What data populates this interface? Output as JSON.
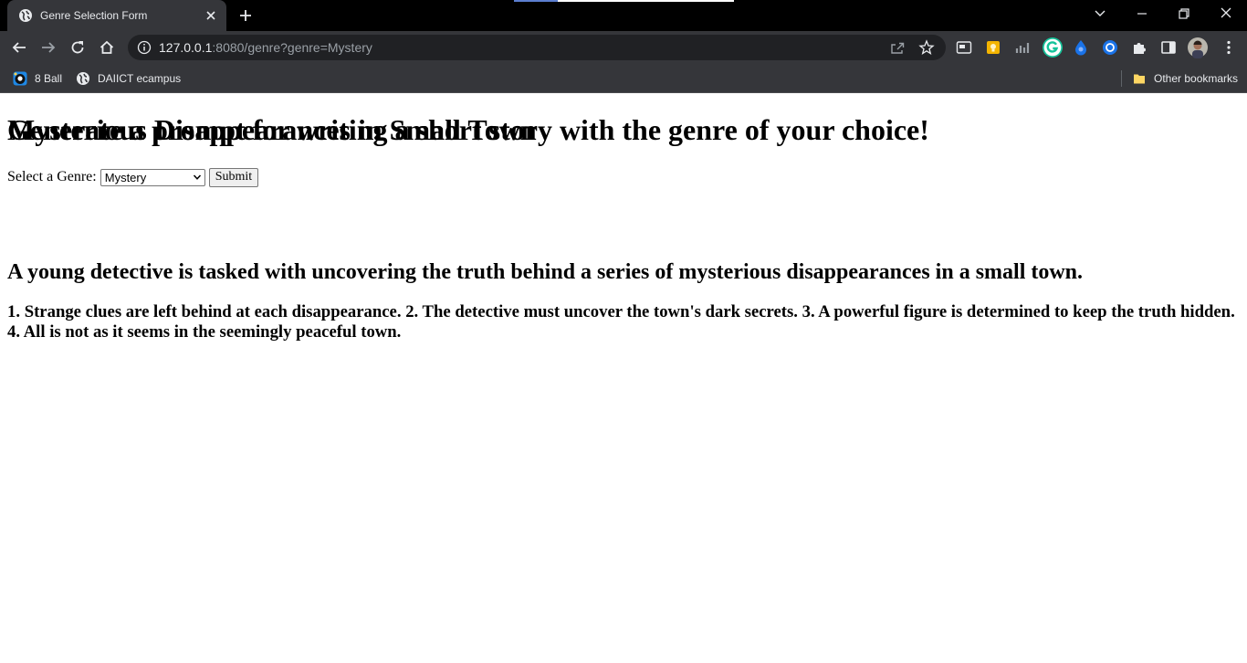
{
  "browser": {
    "tab_title": "Genre Selection Form",
    "url_host": "127.0.0.1",
    "url_rest": ":8080/genre?genre=Mystery",
    "bookmarks": [
      {
        "label": "8 Ball",
        "icon": "magic-8-ball-icon"
      },
      {
        "label": "DAIICT ecampus",
        "icon": "globe-icon"
      }
    ],
    "other_bookmarks": "Other bookmarks"
  },
  "page": {
    "heading": "Generate a prompt for writing a short story with the genre of your choice!",
    "form": {
      "label": "Select a Genre:",
      "selected_genre": "Mystery",
      "submit_label": "Submit"
    },
    "story": {
      "title": "Mysterious Disappearances in Small Town",
      "summary": "A young detective is tasked with uncovering the truth behind a series of mysterious disappearances in a small town.",
      "points": "1. Strange clues are left behind at each disappearance. 2. The detective must uncover the town's dark secrets. 3. A powerful figure is determined to keep the truth hidden. 4. All is not as it seems in the seemingly peaceful town."
    }
  },
  "colors": {
    "chrome_dark": "#35363a",
    "titlebar": "#000000",
    "omnibox": "#202124",
    "chrome_text": "#e8eaed",
    "url_muted": "#9aa0a6"
  }
}
